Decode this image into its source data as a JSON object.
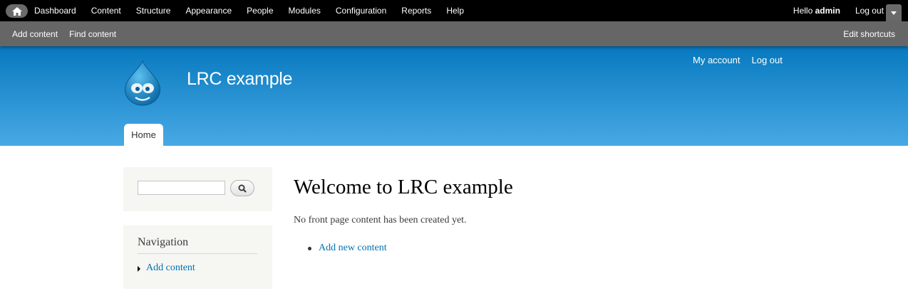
{
  "toolbar": {
    "home_icon": "home-icon",
    "menu": [
      "Dashboard",
      "Content",
      "Structure",
      "Appearance",
      "People",
      "Modules",
      "Configuration",
      "Reports",
      "Help"
    ],
    "hello_prefix": "Hello",
    "username": "admin",
    "logout": "Log out",
    "toggle_icon": "chevron-down-icon"
  },
  "shortcuts": {
    "items": [
      "Add content",
      "Find content"
    ],
    "edit": "Edit shortcuts"
  },
  "header": {
    "site_name": "LRC example",
    "secondary_menu": [
      "My account",
      "Log out"
    ],
    "tabs": [
      "Home"
    ],
    "logo_icon": "drupal-drop-icon"
  },
  "search": {
    "value": "",
    "placeholder": "",
    "button_icon": "search-icon"
  },
  "navigation": {
    "title": "Navigation",
    "items": [
      "Add content"
    ]
  },
  "main": {
    "title": "Welcome to LRC example",
    "message": "No front page content has been created yet.",
    "links": [
      "Add new content"
    ]
  },
  "colors": {
    "toolbar_bg": "#000000",
    "shortcuts_bg": "#666666",
    "header_top": "#0779bf",
    "header_bottom": "#48a9e4",
    "link": "#0071b3",
    "sidebar_bg": "#f6f6f2"
  }
}
